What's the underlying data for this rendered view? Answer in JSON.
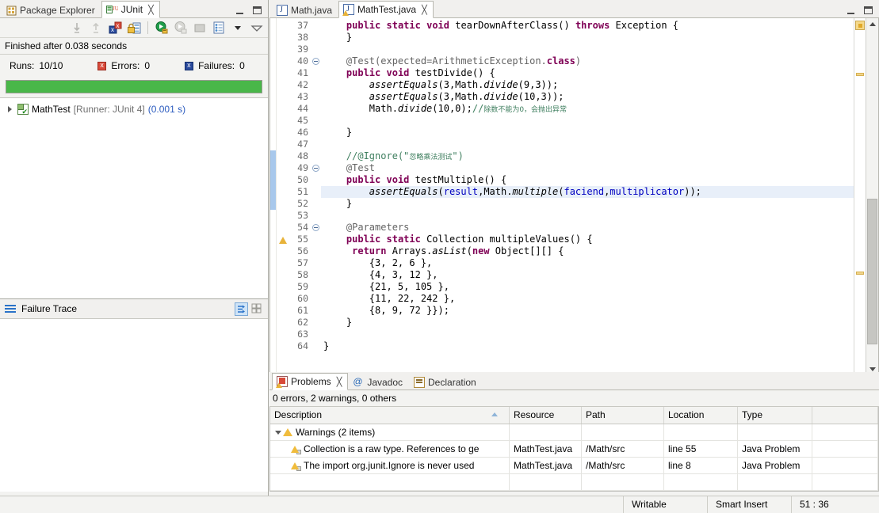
{
  "left_view": {
    "tabs": [
      {
        "label": "Package Explorer",
        "icon": "package-explorer-icon",
        "active": false,
        "closeable": false
      },
      {
        "label": "JUnit",
        "icon": "junit-icon",
        "active": true,
        "closeable": true,
        "close_glyph": "╳"
      }
    ],
    "controls": {
      "minimize": "minimize-view",
      "maximize": "maximize-view"
    },
    "toolbar": [
      "next-failure-icon",
      "previous-failure-icon",
      "show-failures-only-icon",
      "lock-scroll-icon",
      "rerun-test-icon",
      "rerun-failed-icon",
      "stop-icon",
      "test-run-history-icon",
      "view-menu-dropdown-icon",
      "view-menu-icon"
    ],
    "status_text": "Finished after 0.038 seconds",
    "counts": {
      "runs_label": "Runs:",
      "runs_value": "10/10",
      "errors_label": "Errors:",
      "errors_value": "0",
      "failures_label": "Failures:",
      "failures_value": "0"
    },
    "progress": {
      "percent": 100,
      "color": "#49b749"
    },
    "tree": [
      {
        "name": "MathTest",
        "runner": "[Runner: JUnit 4]",
        "time": "(0.001 s)"
      }
    ],
    "failure_trace": {
      "title": "Failure Trace",
      "buttons": [
        "filter-stack-trace-icon",
        "compare-result-icon"
      ]
    }
  },
  "editor": {
    "tabs": [
      {
        "label": "Math.java",
        "icon": "java-file-icon",
        "active": false,
        "closeable": false,
        "warning": false
      },
      {
        "label": "MathTest.java",
        "icon": "java-file-warning-icon",
        "active": true,
        "closeable": true,
        "close_glyph": "╳",
        "warning": true
      }
    ],
    "controls": {
      "minimize": "minimize-editor",
      "maximize": "maximize-editor"
    },
    "current_line": 51,
    "changed_lines": {
      "from": 48,
      "to": 52
    },
    "warning_line": 55,
    "fold_lines": [
      40,
      49,
      54
    ],
    "first_line": 37,
    "lines": [
      {
        "n": 37,
        "tokens": [
          {
            "t": "    ",
            "c": ""
          },
          {
            "t": "public",
            "c": "kw"
          },
          {
            "t": " ",
            "c": ""
          },
          {
            "t": "static",
            "c": "kw"
          },
          {
            "t": " ",
            "c": ""
          },
          {
            "t": "void",
            "c": "kw"
          },
          {
            "t": " tearDownAfterClass() ",
            "c": ""
          },
          {
            "t": "throws",
            "c": "kw"
          },
          {
            "t": " Exception {",
            "c": ""
          }
        ]
      },
      {
        "n": 38,
        "tokens": [
          {
            "t": "    }",
            "c": ""
          }
        ]
      },
      {
        "n": 39,
        "tokens": [
          {
            "t": "",
            "c": ""
          }
        ]
      },
      {
        "n": 40,
        "tokens": [
          {
            "t": "    ",
            "c": ""
          },
          {
            "t": "@Test(expected=ArithmeticException.",
            "c": "ann"
          },
          {
            "t": "class",
            "c": "kw"
          },
          {
            "t": ")",
            "c": "ann"
          }
        ]
      },
      {
        "n": 41,
        "tokens": [
          {
            "t": "    ",
            "c": ""
          },
          {
            "t": "public",
            "c": "kw"
          },
          {
            "t": " ",
            "c": ""
          },
          {
            "t": "void",
            "c": "kw"
          },
          {
            "t": " testDivide() {",
            "c": ""
          }
        ]
      },
      {
        "n": 42,
        "tokens": [
          {
            "t": "        ",
            "c": ""
          },
          {
            "t": "assertEquals",
            "c": "mthi"
          },
          {
            "t": "(3,Math.",
            "c": ""
          },
          {
            "t": "divide",
            "c": "mthi"
          },
          {
            "t": "(9,3));",
            "c": ""
          }
        ]
      },
      {
        "n": 43,
        "tokens": [
          {
            "t": "        ",
            "c": ""
          },
          {
            "t": "assertEquals",
            "c": "mthi"
          },
          {
            "t": "(3,Math.",
            "c": ""
          },
          {
            "t": "divide",
            "c": "mthi"
          },
          {
            "t": "(10,3));",
            "c": ""
          }
        ]
      },
      {
        "n": 44,
        "tokens": [
          {
            "t": "        Math.",
            "c": ""
          },
          {
            "t": "divide",
            "c": "mthi"
          },
          {
            "t": "(10,0);",
            "c": ""
          },
          {
            "t": "//",
            "c": "cmt"
          },
          {
            "t": "除数不能为0，会抛出异常",
            "c": "cn-cmt"
          }
        ]
      },
      {
        "n": 45,
        "tokens": [
          {
            "t": "",
            "c": ""
          }
        ]
      },
      {
        "n": 46,
        "tokens": [
          {
            "t": "    }",
            "c": ""
          }
        ]
      },
      {
        "n": 47,
        "tokens": [
          {
            "t": "",
            "c": ""
          }
        ]
      },
      {
        "n": 48,
        "tokens": [
          {
            "t": "    ",
            "c": ""
          },
          {
            "t": "//@Ignore(\"",
            "c": "cmt"
          },
          {
            "t": "忽略乘法测试",
            "c": "cn-cmt"
          },
          {
            "t": "\")",
            "c": "cmt"
          }
        ]
      },
      {
        "n": 49,
        "tokens": [
          {
            "t": "    ",
            "c": ""
          },
          {
            "t": "@Test",
            "c": "ann"
          }
        ]
      },
      {
        "n": 50,
        "tokens": [
          {
            "t": "    ",
            "c": ""
          },
          {
            "t": "public",
            "c": "kw"
          },
          {
            "t": " ",
            "c": ""
          },
          {
            "t": "void",
            "c": "kw"
          },
          {
            "t": " testMultiple() {",
            "c": ""
          }
        ]
      },
      {
        "n": 51,
        "tokens": [
          {
            "t": "        ",
            "c": ""
          },
          {
            "t": "assertEquals",
            "c": "mthi"
          },
          {
            "t": "(",
            "c": ""
          },
          {
            "t": "result",
            "c": "fld"
          },
          {
            "t": ",Math.",
            "c": ""
          },
          {
            "t": "multiple",
            "c": "mthi"
          },
          {
            "t": "(",
            "c": ""
          },
          {
            "t": "faciend",
            "c": "fld"
          },
          {
            "t": ",",
            "c": ""
          },
          {
            "t": "multiplicator",
            "c": "fld"
          },
          {
            "t": "));",
            "c": ""
          }
        ]
      },
      {
        "n": 52,
        "tokens": [
          {
            "t": "    }",
            "c": ""
          }
        ]
      },
      {
        "n": 53,
        "tokens": [
          {
            "t": "",
            "c": ""
          }
        ]
      },
      {
        "n": 54,
        "tokens": [
          {
            "t": "    ",
            "c": ""
          },
          {
            "t": "@Parameters",
            "c": "ann"
          }
        ]
      },
      {
        "n": 55,
        "tokens": [
          {
            "t": "    ",
            "c": ""
          },
          {
            "t": "public",
            "c": "kw"
          },
          {
            "t": " ",
            "c": ""
          },
          {
            "t": "static",
            "c": "kw"
          },
          {
            "t": " Collection multipleValues() {",
            "c": ""
          }
        ]
      },
      {
        "n": 56,
        "tokens": [
          {
            "t": "     ",
            "c": ""
          },
          {
            "t": "return",
            "c": "kw"
          },
          {
            "t": " Arrays.",
            "c": ""
          },
          {
            "t": "asList",
            "c": "mthi"
          },
          {
            "t": "(",
            "c": ""
          },
          {
            "t": "new",
            "c": "kw"
          },
          {
            "t": " Object[][] {",
            "c": ""
          }
        ]
      },
      {
        "n": 57,
        "tokens": [
          {
            "t": "        {3, 2, 6 },",
            "c": ""
          }
        ]
      },
      {
        "n": 58,
        "tokens": [
          {
            "t": "        {4, 3, 12 },",
            "c": ""
          }
        ]
      },
      {
        "n": 59,
        "tokens": [
          {
            "t": "        {21, 5, 105 },",
            "c": ""
          }
        ]
      },
      {
        "n": 60,
        "tokens": [
          {
            "t": "        {11, 22, 242 },",
            "c": ""
          }
        ]
      },
      {
        "n": 61,
        "tokens": [
          {
            "t": "        {8, 9, 72 }});",
            "c": ""
          }
        ]
      },
      {
        "n": 62,
        "tokens": [
          {
            "t": "    }",
            "c": ""
          }
        ]
      },
      {
        "n": 63,
        "tokens": [
          {
            "t": "",
            "c": ""
          }
        ]
      },
      {
        "n": 64,
        "tokens": [
          {
            "t": "}",
            "c": ""
          }
        ]
      }
    ]
  },
  "problems": {
    "tabs": [
      {
        "label": "Problems",
        "icon": "problems-icon",
        "active": true,
        "closeable": true,
        "close_glyph": "╳"
      },
      {
        "label": "Javadoc",
        "icon": "javadoc-icon",
        "active": false,
        "closeable": false
      },
      {
        "label": "Declaration",
        "icon": "declaration-icon",
        "active": false,
        "closeable": false
      }
    ],
    "summary": "0 errors, 2 warnings, 0 others",
    "columns": [
      "Description",
      "Resource",
      "Path",
      "Location",
      "Type"
    ],
    "sorted_column": "Description",
    "group": {
      "label": "Warnings (2 items)",
      "expanded": true
    },
    "rows": [
      {
        "description": "Collection is a raw type. References to ge",
        "resource": "MathTest.java",
        "path": "/Math/src",
        "location": "line 55",
        "type": "Java Problem"
      },
      {
        "description": "The import org.junit.Ignore is never used",
        "resource": "MathTest.java",
        "path": "/Math/src",
        "location": "line 8",
        "type": "Java Problem"
      }
    ]
  },
  "statusbar": {
    "writable": "Writable",
    "insert_mode": "Smart Insert",
    "cursor_position": "51 : 36"
  }
}
